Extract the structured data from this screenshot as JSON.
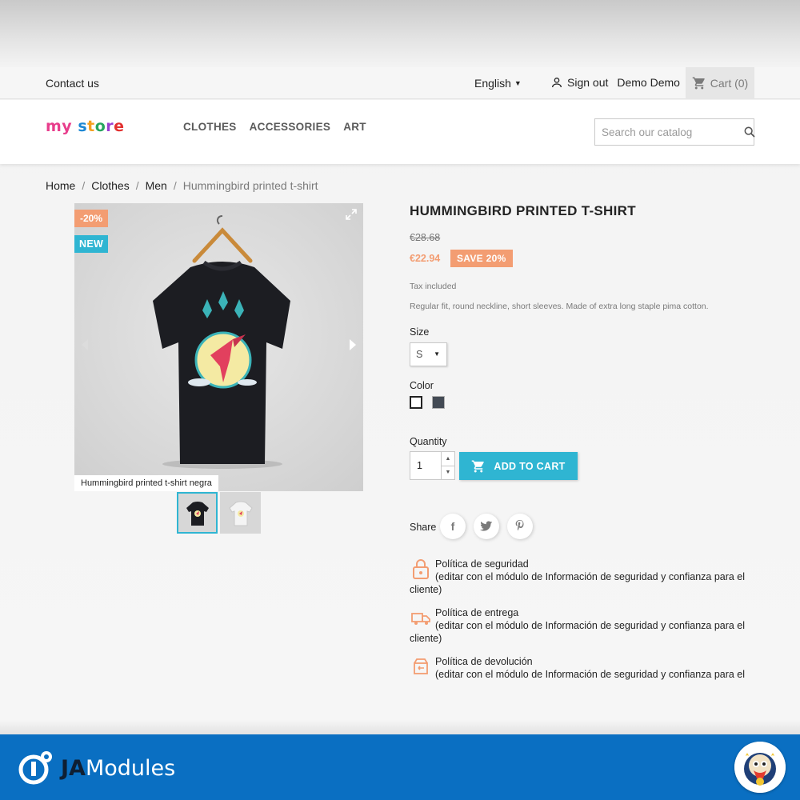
{
  "topbar": {
    "contact": "Contact us",
    "language": "English",
    "sign_out": "Sign out",
    "user_name": "Demo Demo",
    "cart": "Cart (0)"
  },
  "header": {
    "logo": [
      "my",
      " ",
      "s",
      "t",
      "o",
      "r",
      "e"
    ],
    "nav": [
      "CLOTHES",
      "ACCESSORIES",
      "ART"
    ],
    "search_placeholder": "Search our catalog"
  },
  "breadcrumb": [
    "Home",
    "Clothes",
    "Men",
    "Hummingbird printed t-shirt"
  ],
  "gallery": {
    "discount_badge": "-20%",
    "new_badge": "NEW",
    "caption": "Hummingbird printed t-shirt negra",
    "thumbnails": [
      "black",
      "white"
    ]
  },
  "product": {
    "title": "HUMMINGBIRD PRINTED T-SHIRT",
    "old_price": "€28.68",
    "price": "€22.94",
    "save": "SAVE 20%",
    "tax": "Tax included",
    "description": "Regular fit, round neckline, short sleeves. Made of extra long staple pima cotton.",
    "size_label": "Size",
    "size_value": "S",
    "color_label": "Color",
    "colors": [
      "#ffffff",
      "#434a54"
    ],
    "quantity_label": "Quantity",
    "quantity_value": "1",
    "add_to_cart": "ADD TO CART",
    "share_label": "Share",
    "share": [
      "facebook-icon",
      "twitter-icon",
      "pinterest-icon"
    ]
  },
  "policies": [
    {
      "title": "Política de seguridad",
      "text": "(editar con el módulo de Información de seguridad y confianza para el cliente)"
    },
    {
      "title": "Política de entrega",
      "text": "(editar con el módulo de Información de seguridad y confianza para el cliente)"
    },
    {
      "title": "Política de devolución",
      "text": "(editar con el módulo de Información de seguridad y confianza para el"
    }
  ],
  "footer": {
    "brand_ja": "JA",
    "brand_modules": "Modules"
  },
  "colors": {
    "accent": "#2fb5d2",
    "discount": "#f39d72",
    "footer": "#0a6fc2"
  }
}
